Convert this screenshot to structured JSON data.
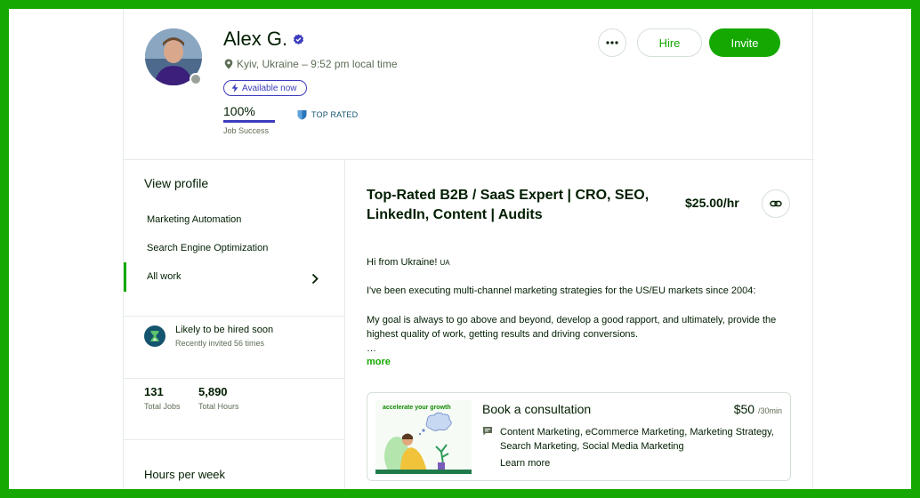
{
  "profile": {
    "name": "Alex G.",
    "location": "Kyiv, Ukraine – 9:52 pm local time",
    "availability": "Available now",
    "job_success_value": "100%",
    "job_success_label": "Job Success",
    "job_success_fraction": 1.0,
    "badge": "TOP RATED"
  },
  "actions": {
    "hire_label": "Hire",
    "invite_label": "Invite"
  },
  "sidebar": {
    "title": "View profile",
    "items": [
      {
        "label": "Marketing Automation"
      },
      {
        "label": "Search Engine Optimization"
      },
      {
        "label": "All work"
      }
    ],
    "likely_title": "Likely to be hired soon",
    "likely_sub": "Recently invited 56 times",
    "stats": [
      {
        "value": "131",
        "label": "Total Jobs"
      },
      {
        "value": "5,890",
        "label": "Total Hours"
      }
    ],
    "hours_per_week": "Hours per week"
  },
  "main": {
    "title": "Top-Rated B2B / SaaS Expert | CRO, SEO, LinkedIn, Content | Audits",
    "rate": "$25.00/hr",
    "greeting": "Hi from Ukraine!",
    "greeting_flag": "UA",
    "para1": "I've been executing multi-channel marketing strategies for the US/EU markets since 2004:",
    "para2": "My goal is always to go above and beyond, develop a good rapport, and ultimately, provide the highest quality of work, getting results and driving conversions.",
    "ellipsis": "…",
    "more": "more"
  },
  "consultation": {
    "title": "Book a consultation",
    "price": "$50",
    "unit": "/30min",
    "skills": "Content Marketing, eCommerce Marketing, Marketing Strategy, Search Marketing, Social Media Marketing",
    "learn_more": "Learn more",
    "image_text": "accelerate your growth"
  },
  "colors": {
    "brand_green": "#14a800",
    "availability_blue": "#3c3cbd",
    "top_rated": "#2a75b8",
    "text": "#001e00",
    "muted": "#5e6d55"
  },
  "icons": [
    "verified-badge-icon",
    "location-pin-icon",
    "lightning-icon",
    "top-rated-shield-icon",
    "more-dots-icon",
    "chevron-right-icon",
    "hourglass-icon",
    "link-icon",
    "chat-icon"
  ]
}
